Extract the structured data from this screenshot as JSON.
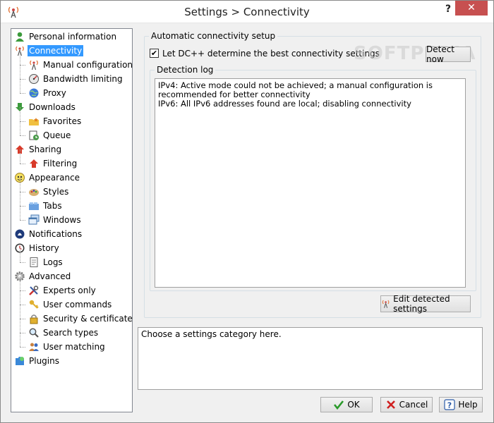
{
  "window": {
    "title": "Settings > Connectivity",
    "help_label": "?",
    "close_label": "✕"
  },
  "tree": {
    "items": [
      {
        "label": "Personal information",
        "level": 0,
        "icon": "user-icon"
      },
      {
        "label": "Connectivity",
        "level": 0,
        "icon": "antenna-icon",
        "selected": true
      },
      {
        "label": "Manual configuration",
        "level": 1,
        "icon": "antenna-icon"
      },
      {
        "label": "Bandwidth limiting",
        "level": 1,
        "icon": "gauge-icon"
      },
      {
        "label": "Proxy",
        "level": 1,
        "icon": "globe-icon"
      },
      {
        "label": "Downloads",
        "level": 0,
        "icon": "download-arrow-icon"
      },
      {
        "label": "Favorites",
        "level": 1,
        "icon": "favorites-folder-icon"
      },
      {
        "label": "Queue",
        "level": 1,
        "icon": "queue-icon"
      },
      {
        "label": "Sharing",
        "level": 0,
        "icon": "upload-arrow-icon"
      },
      {
        "label": "Filtering",
        "level": 1,
        "icon": "upload-arrow-icon"
      },
      {
        "label": "Appearance",
        "level": 0,
        "icon": "appearance-icon"
      },
      {
        "label": "Styles",
        "level": 1,
        "icon": "palette-icon"
      },
      {
        "label": "Tabs",
        "level": 1,
        "icon": "tabs-icon"
      },
      {
        "label": "Windows",
        "level": 1,
        "icon": "windows-icon"
      },
      {
        "label": "Notifications",
        "level": 0,
        "icon": "notifications-icon"
      },
      {
        "label": "History",
        "level": 0,
        "icon": "clock-icon"
      },
      {
        "label": "Logs",
        "level": 1,
        "icon": "log-file-icon"
      },
      {
        "label": "Advanced",
        "level": 0,
        "icon": "gear-icon"
      },
      {
        "label": "Experts only",
        "level": 1,
        "icon": "tools-icon"
      },
      {
        "label": "User commands",
        "level": 1,
        "icon": "key-icon"
      },
      {
        "label": "Security & certificates",
        "level": 1,
        "icon": "lock-icon"
      },
      {
        "label": "Search types",
        "level": 1,
        "icon": "magnifier-icon"
      },
      {
        "label": "User matching",
        "level": 1,
        "icon": "users-icon"
      },
      {
        "label": "Plugins",
        "level": 0,
        "icon": "plugin-icon"
      }
    ]
  },
  "auto": {
    "group_title": "Automatic connectivity setup",
    "checkbox_label": "Let DC++ determine the best connectivity settings",
    "checkbox_checked": true,
    "detect_label": "Detect now",
    "log_title": "Detection log",
    "log_lines": [
      "IPv4: Active mode could not be achieved; a manual configuration is recommended for better connectivity",
      "IPv6: All IPv6 addresses found are local; disabling connectivity"
    ],
    "edit_label": "Edit detected settings"
  },
  "help_text": "Choose a settings category here.",
  "footer": {
    "ok_label": "OK",
    "cancel_label": "Cancel",
    "help_label": "Help"
  },
  "watermark": "SOFTPEDIA"
}
